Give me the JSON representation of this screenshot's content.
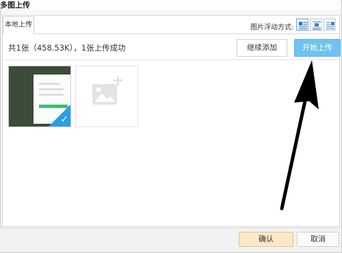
{
  "dialog": {
    "title": "多图上传"
  },
  "tabs": [
    {
      "label": "本地上传"
    }
  ],
  "float_mode": {
    "label": "图片浮动方式:",
    "options": [
      "left-float",
      "center",
      "right-float",
      "none"
    ]
  },
  "summary": {
    "text": "共1张（458.53K），1张上传成功"
  },
  "buttons": {
    "continue_add": "继续添加",
    "start_upload": "开始上传",
    "confirm": "确认",
    "cancel": "取消"
  },
  "colors": {
    "start_button": "#6ec3f0",
    "confirm_button": "#fbe8c6",
    "check_corner": "#2a9ee8",
    "arrow": "#000000"
  }
}
